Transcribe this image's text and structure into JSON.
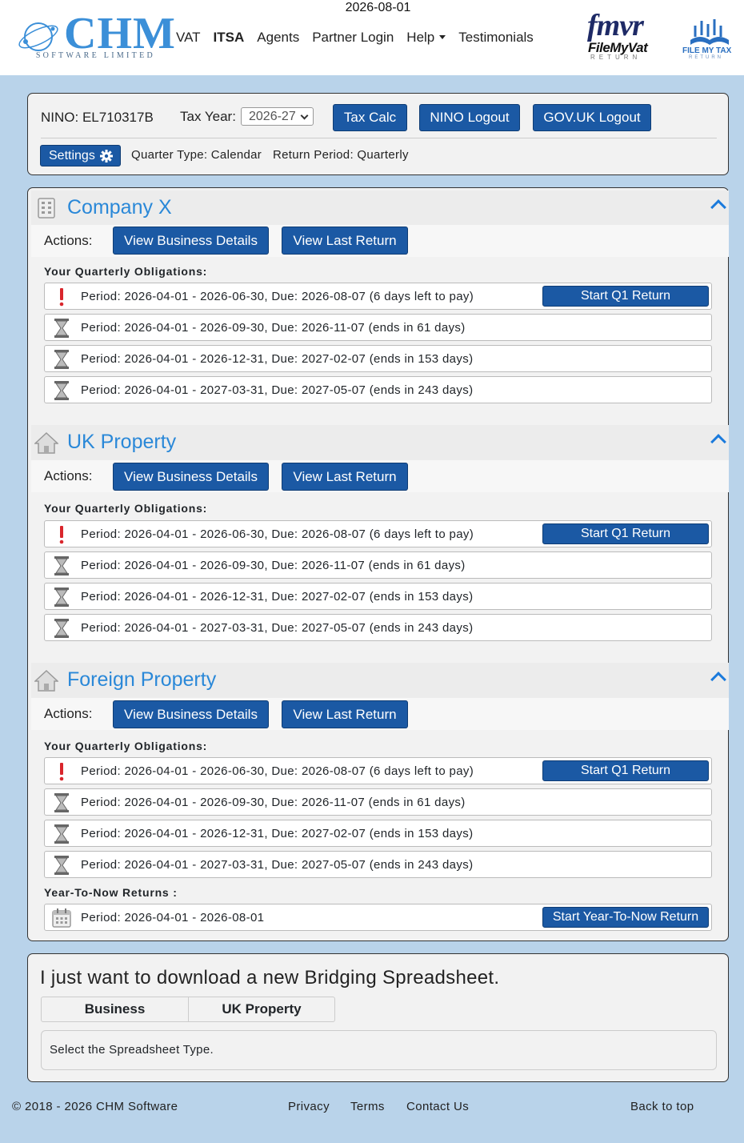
{
  "header": {
    "date": "2026-08-01",
    "logo_text": "CHM",
    "logo_subtitle": "SOFTWARE LIMITED",
    "nav": [
      {
        "label": "VAT",
        "active": false
      },
      {
        "label": "ITSA",
        "active": true
      },
      {
        "label": "Agents",
        "active": false
      },
      {
        "label": "Partner Login",
        "active": false
      },
      {
        "label": "Help",
        "active": false,
        "dropdown": true
      },
      {
        "label": "Testimonials",
        "active": false
      }
    ],
    "partner_logos": {
      "filemyvat_mark": "fmvr",
      "filemyvat_name": "FileMyVat",
      "filemyvat_sub": "RETURN",
      "filemytax_name": "FILE MY TAX",
      "filemytax_sub": "RETURN"
    }
  },
  "toolbar": {
    "nino": "NINO: EL710317B",
    "tax_year_label": "Tax Year:",
    "tax_year_value": "2026-27",
    "tax_calc": "Tax Calc",
    "nino_logout": "NINO Logout",
    "gov_logout": "GOV.UK Logout",
    "settings": "Settings",
    "quarter_type": "Quarter Type: Calendar",
    "return_period": "Return Period: Quarterly"
  },
  "businesses": [
    {
      "name": "Company X",
      "icon": "building-icon",
      "actions_label": "Actions:",
      "view_details": "View Business Details",
      "view_last": "View Last Return",
      "obligations_label": "Your Quarterly Obligations:",
      "obligations": [
        {
          "text": "Period: 2026-04-01 - 2026-06-30, Due: 2026-08-07 (6 days left to pay)",
          "status": "urgent",
          "button": "Start Q1 Return"
        },
        {
          "text": "Period: 2026-04-01 - 2026-09-30, Due: 2026-11-07 (ends in 61 days)",
          "status": "pending"
        },
        {
          "text": "Period: 2026-04-01 - 2026-12-31, Due: 2027-02-07 (ends in 153 days)",
          "status": "pending"
        },
        {
          "text": "Period: 2026-04-01 - 2027-03-31, Due: 2027-05-07 (ends in 243 days)",
          "status": "pending"
        }
      ]
    },
    {
      "name": "UK Property",
      "icon": "house-icon",
      "actions_label": "Actions:",
      "view_details": "View Business Details",
      "view_last": "View Last Return",
      "obligations_label": "Your Quarterly Obligations:",
      "obligations": [
        {
          "text": "Period: 2026-04-01 - 2026-06-30, Due: 2026-08-07 (6 days left to pay)",
          "status": "urgent",
          "button": "Start Q1 Return"
        },
        {
          "text": "Period: 2026-04-01 - 2026-09-30, Due: 2026-11-07 (ends in 61 days)",
          "status": "pending"
        },
        {
          "text": "Period: 2026-04-01 - 2026-12-31, Due: 2027-02-07 (ends in 153 days)",
          "status": "pending"
        },
        {
          "text": "Period: 2026-04-01 - 2027-03-31, Due: 2027-05-07 (ends in 243 days)",
          "status": "pending"
        }
      ]
    },
    {
      "name": "Foreign Property",
      "icon": "house-icon",
      "actions_label": "Actions:",
      "view_details": "View Business Details",
      "view_last": "View Last Return",
      "obligations_label": "Your Quarterly Obligations:",
      "obligations": [
        {
          "text": "Period: 2026-04-01 - 2026-06-30, Due: 2026-08-07 (6 days left to pay)",
          "status": "urgent",
          "button": "Start Q1 Return"
        },
        {
          "text": "Period: 2026-04-01 - 2026-09-30, Due: 2026-11-07 (ends in 61 days)",
          "status": "pending"
        },
        {
          "text": "Period: 2026-04-01 - 2026-12-31, Due: 2027-02-07 (ends in 153 days)",
          "status": "pending"
        },
        {
          "text": "Period: 2026-04-01 - 2027-03-31, Due: 2027-05-07 (ends in 243 days)",
          "status": "pending"
        }
      ],
      "ytn_label": "Year-To-Now Returns :",
      "ytn": {
        "text": "Period: 2026-04-01 - 2026-08-01",
        "button": "Start Year-To-Now Return"
      }
    }
  ],
  "bridging": {
    "title": "I just want to download a new Bridging Spreadsheet.",
    "tabs": [
      "Business",
      "UK Property"
    ],
    "hint": "Select the Spreadsheet Type."
  },
  "footer": {
    "copyright": "© 2018 - 2026 CHM Software",
    "privacy": "Privacy",
    "terms": "Terms",
    "contact": "Contact Us",
    "back_to_top": "Back to top"
  },
  "colors": {
    "page_bg": "#b9d3ea",
    "button": "#1b59a4",
    "title_blue": "#2a88d8",
    "urgent": "#d9262c"
  }
}
